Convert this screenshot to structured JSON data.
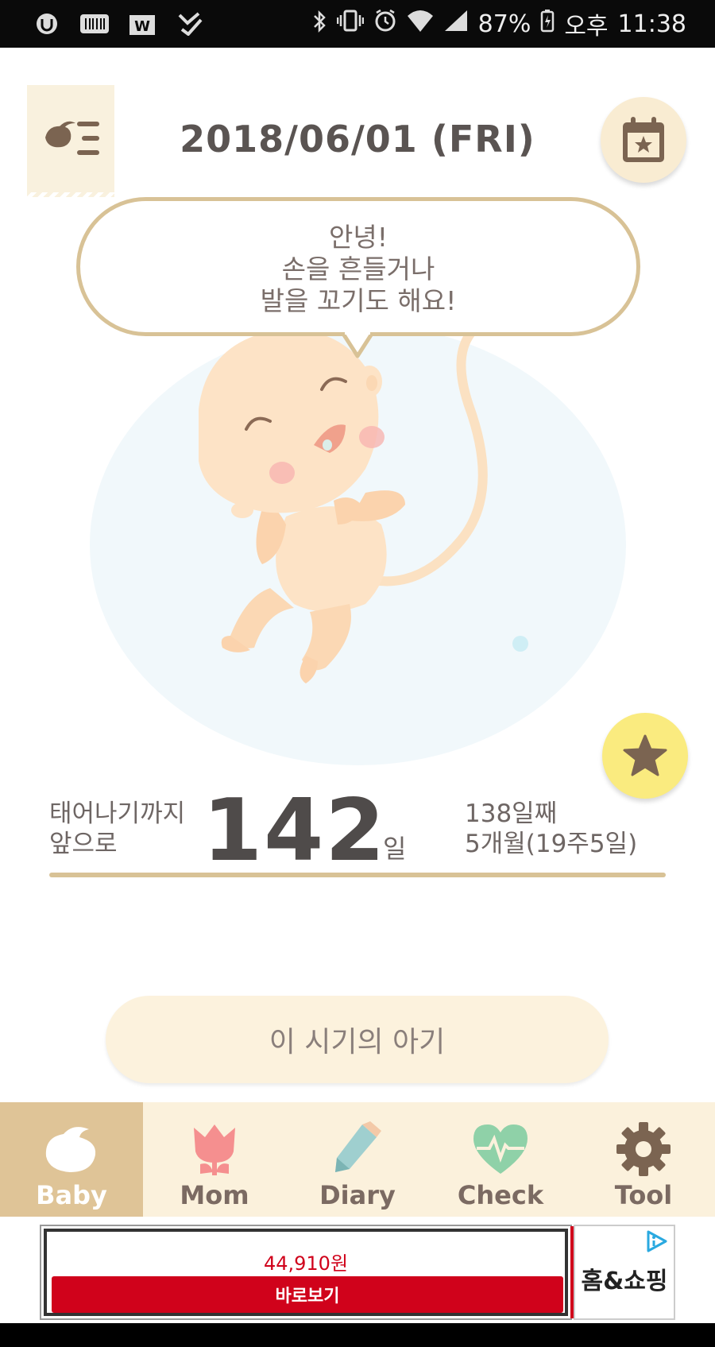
{
  "status_bar": {
    "battery": "87%",
    "ampm": "오후",
    "time": "11:38",
    "left_icons": [
      "u-plus-icon",
      "barcode-icon",
      "w-app-icon",
      "check-app-icon"
    ],
    "right_icons": [
      "bluetooth-icon",
      "vibrate-icon",
      "alarm-icon",
      "wifi-icon",
      "signal-icon",
      "battery-icon"
    ]
  },
  "header": {
    "date": "2018/06/01 (FRI)"
  },
  "bubble": {
    "lines": [
      "안녕!",
      "손을 흔들거나",
      "발을 꼬기도 해요!"
    ]
  },
  "countdown": {
    "label_line1": "태어나기까지",
    "label_line2": "앞으로",
    "days_left": "142",
    "unit": "일",
    "day_count": "138일째",
    "month_week": "5개월(19주5일)"
  },
  "baby_period_button": "이 시기의 아기",
  "tabs": [
    {
      "label": "Baby",
      "icon": "bird-icon",
      "active": true
    },
    {
      "label": "Mom",
      "icon": "tulip-icon",
      "active": false
    },
    {
      "label": "Diary",
      "icon": "pencil-icon",
      "active": false
    },
    {
      "label": "Check",
      "icon": "heart-pulse-icon",
      "active": false
    },
    {
      "label": "Tool",
      "icon": "gear-icon",
      "active": false
    }
  ],
  "ad": {
    "price": "44,910원",
    "button": "바로보기",
    "logo_text": "홈&쇼핑"
  },
  "colors": {
    "accent_tan": "#dfc497",
    "bubble_border": "#d8c296",
    "tab_bg": "#fbf1dc",
    "ad_red": "#d0021b",
    "favorite_yellow": "#faeb7f"
  }
}
